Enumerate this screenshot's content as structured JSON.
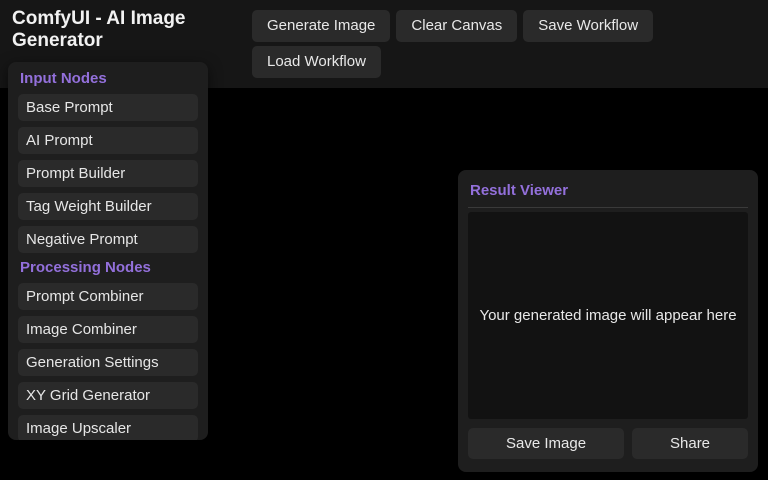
{
  "header": {
    "title": "ComfyUI - AI Image Generator",
    "buttons": [
      "Generate Image",
      "Clear Canvas",
      "Save Workflow",
      "Load Workflow"
    ]
  },
  "node_palette": {
    "sections": [
      {
        "title": "Input Nodes",
        "items": [
          "Base Prompt",
          "AI Prompt",
          "Prompt Builder",
          "Tag Weight Builder",
          "Negative Prompt"
        ]
      },
      {
        "title": "Processing Nodes",
        "items": [
          "Prompt Combiner",
          "Image Combiner",
          "Generation Settings",
          "XY Grid Generator",
          "Image Upscaler"
        ]
      }
    ]
  },
  "result_viewer": {
    "title": "Result Viewer",
    "placeholder": "Your generated image will appear here",
    "buttons": [
      "Save Image",
      "Share"
    ]
  },
  "colors": {
    "page_background": "#000000",
    "header_background": "#161616",
    "panel_background": "#1e1e1e",
    "control_background": "#2a2a2a",
    "image_area_background": "#121212",
    "accent_purple": "#9370db",
    "text_primary": "#f2f2f2"
  }
}
